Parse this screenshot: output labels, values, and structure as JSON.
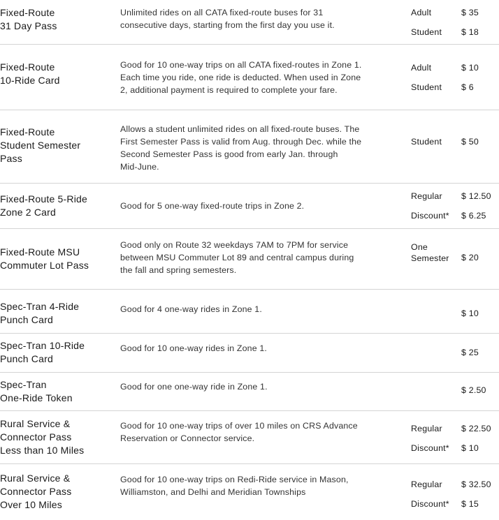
{
  "fares": [
    {
      "name_lines": [
        "Fixed-Route",
        "31 Day Pass"
      ],
      "desc_lines": [
        "Unlimited rides on all CATA fixed-route buses for 31",
        "consecutive days, starting from the first day you use it."
      ],
      "prices": [
        {
          "category": "Adult",
          "amount": "$ 35"
        },
        {
          "category": "Student",
          "amount": "$ 18"
        }
      ]
    },
    {
      "name_lines": [
        "Fixed-Route",
        "10-Ride Card"
      ],
      "desc_lines": [
        "Good for 10 one-way trips on all CATA fixed-routes in Zone 1.",
        "Each time you ride, one ride is deducted. When used in Zone",
        "2, additional payment is required to complete your fare."
      ],
      "prices": [
        {
          "category": "Adult",
          "amount": "$ 10"
        },
        {
          "category": "Student",
          "amount": "$ 6"
        }
      ]
    },
    {
      "name_lines": [
        "Fixed-Route",
        "Student Semester",
        "Pass"
      ],
      "desc_lines": [
        "Allows a student unlimited rides on all fixed-route buses. The",
        "First Semester Pass is valid from Aug. through Dec. while the",
        "Second Semester Pass is good from early Jan. through",
        "Mid-June."
      ],
      "prices": [
        {
          "category": "Student",
          "amount": "$ 50"
        }
      ]
    },
    {
      "name_lines": [
        "Fixed-Route 5-Ride",
        "Zone 2 Card"
      ],
      "desc_lines": [
        "Good for 5 one-way fixed-route trips in Zone 2."
      ],
      "prices": [
        {
          "category": "Regular",
          "amount": "$ 12.50"
        },
        {
          "category": "Discount*",
          "amount": "$ 6.25"
        }
      ]
    },
    {
      "name_lines": [
        "Fixed-Route MSU",
        "Commuter Lot Pass"
      ],
      "desc_lines": [
        "Good only on Route 32 weekdays 7AM to 7PM for service",
        "between MSU Commuter Lot 89 and central campus during",
        "the fall and spring semesters."
      ],
      "prices": [
        {
          "category_lines": [
            "One",
            "Semester"
          ],
          "amount": "$ 20"
        }
      ]
    },
    {
      "name_lines": [
        "Spec-Tran 4-Ride",
        "Punch Card"
      ],
      "desc_lines": [
        "Good for 4 one-way rides in Zone 1."
      ],
      "prices": [
        {
          "category": "",
          "amount": "$ 10"
        }
      ]
    },
    {
      "name_lines": [
        "Spec-Tran 10-Ride",
        "Punch Card"
      ],
      "desc_lines": [
        "Good for 10 one-way rides in Zone 1."
      ],
      "prices": [
        {
          "category": "",
          "amount": "$ 25"
        }
      ]
    },
    {
      "name_lines": [
        "Spec-Tran",
        "One-Ride Token"
      ],
      "desc_lines": [
        "Good for one one-way ride in Zone 1."
      ],
      "prices": [
        {
          "category": "",
          "amount": "$ 2.50"
        }
      ]
    },
    {
      "name_lines": [
        "Rural Service &",
        "Connector Pass",
        "Less than 10 Miles"
      ],
      "desc_lines": [
        "Good for 10 one-way trips of over 10 miles on CRS Advance",
        "Reservation or Connector service."
      ],
      "prices": [
        {
          "category": "Regular",
          "amount": "$ 22.50"
        },
        {
          "category": "Discount*",
          "amount": "$ 10"
        }
      ]
    },
    {
      "name_lines": [
        "Rural Service &",
        "Connector Pass",
        "Over 10 Miles"
      ],
      "desc_lines": [
        "Good for 10 one-way trips on Redi-Ride service in Mason,",
        "Williamston, and Delhi and Meridian Townships"
      ],
      "prices": [
        {
          "category": "Regular",
          "amount": "$ 32.50"
        },
        {
          "category": "Discount*",
          "amount": "$ 15"
        }
      ]
    }
  ]
}
